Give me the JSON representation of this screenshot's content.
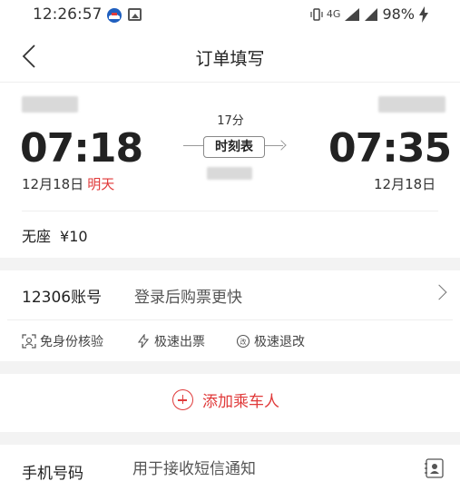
{
  "status_bar": {
    "time": "12:26:57",
    "network": "4G",
    "battery": "98%"
  },
  "header": {
    "title": "订单填写",
    "back_icon": "chevron-left-icon"
  },
  "train": {
    "duration": "17分",
    "depart_time": "07:18",
    "depart_date": "12月18日",
    "depart_day_tag": "明天",
    "schedule_label": "时刻表",
    "arrive_time": "07:35",
    "arrive_date": "12月18日",
    "seat_type": "无座",
    "price": "¥10"
  },
  "account": {
    "label": "12306账号",
    "hint": "登录后购票更快"
  },
  "features": [
    {
      "icon": "face-scan-icon",
      "label": "免身份核验"
    },
    {
      "icon": "lightning-icon",
      "label": "极速出票"
    },
    {
      "icon": "refund-icon",
      "label": "极速退改"
    }
  ],
  "add_passenger": {
    "label": "添加乘车人"
  },
  "phone": {
    "label": "手机号码",
    "placeholder": "用于接收短信通知",
    "value": ""
  },
  "colors": {
    "accent": "#e03a3a",
    "gap_bg": "#f3f3f3"
  }
}
